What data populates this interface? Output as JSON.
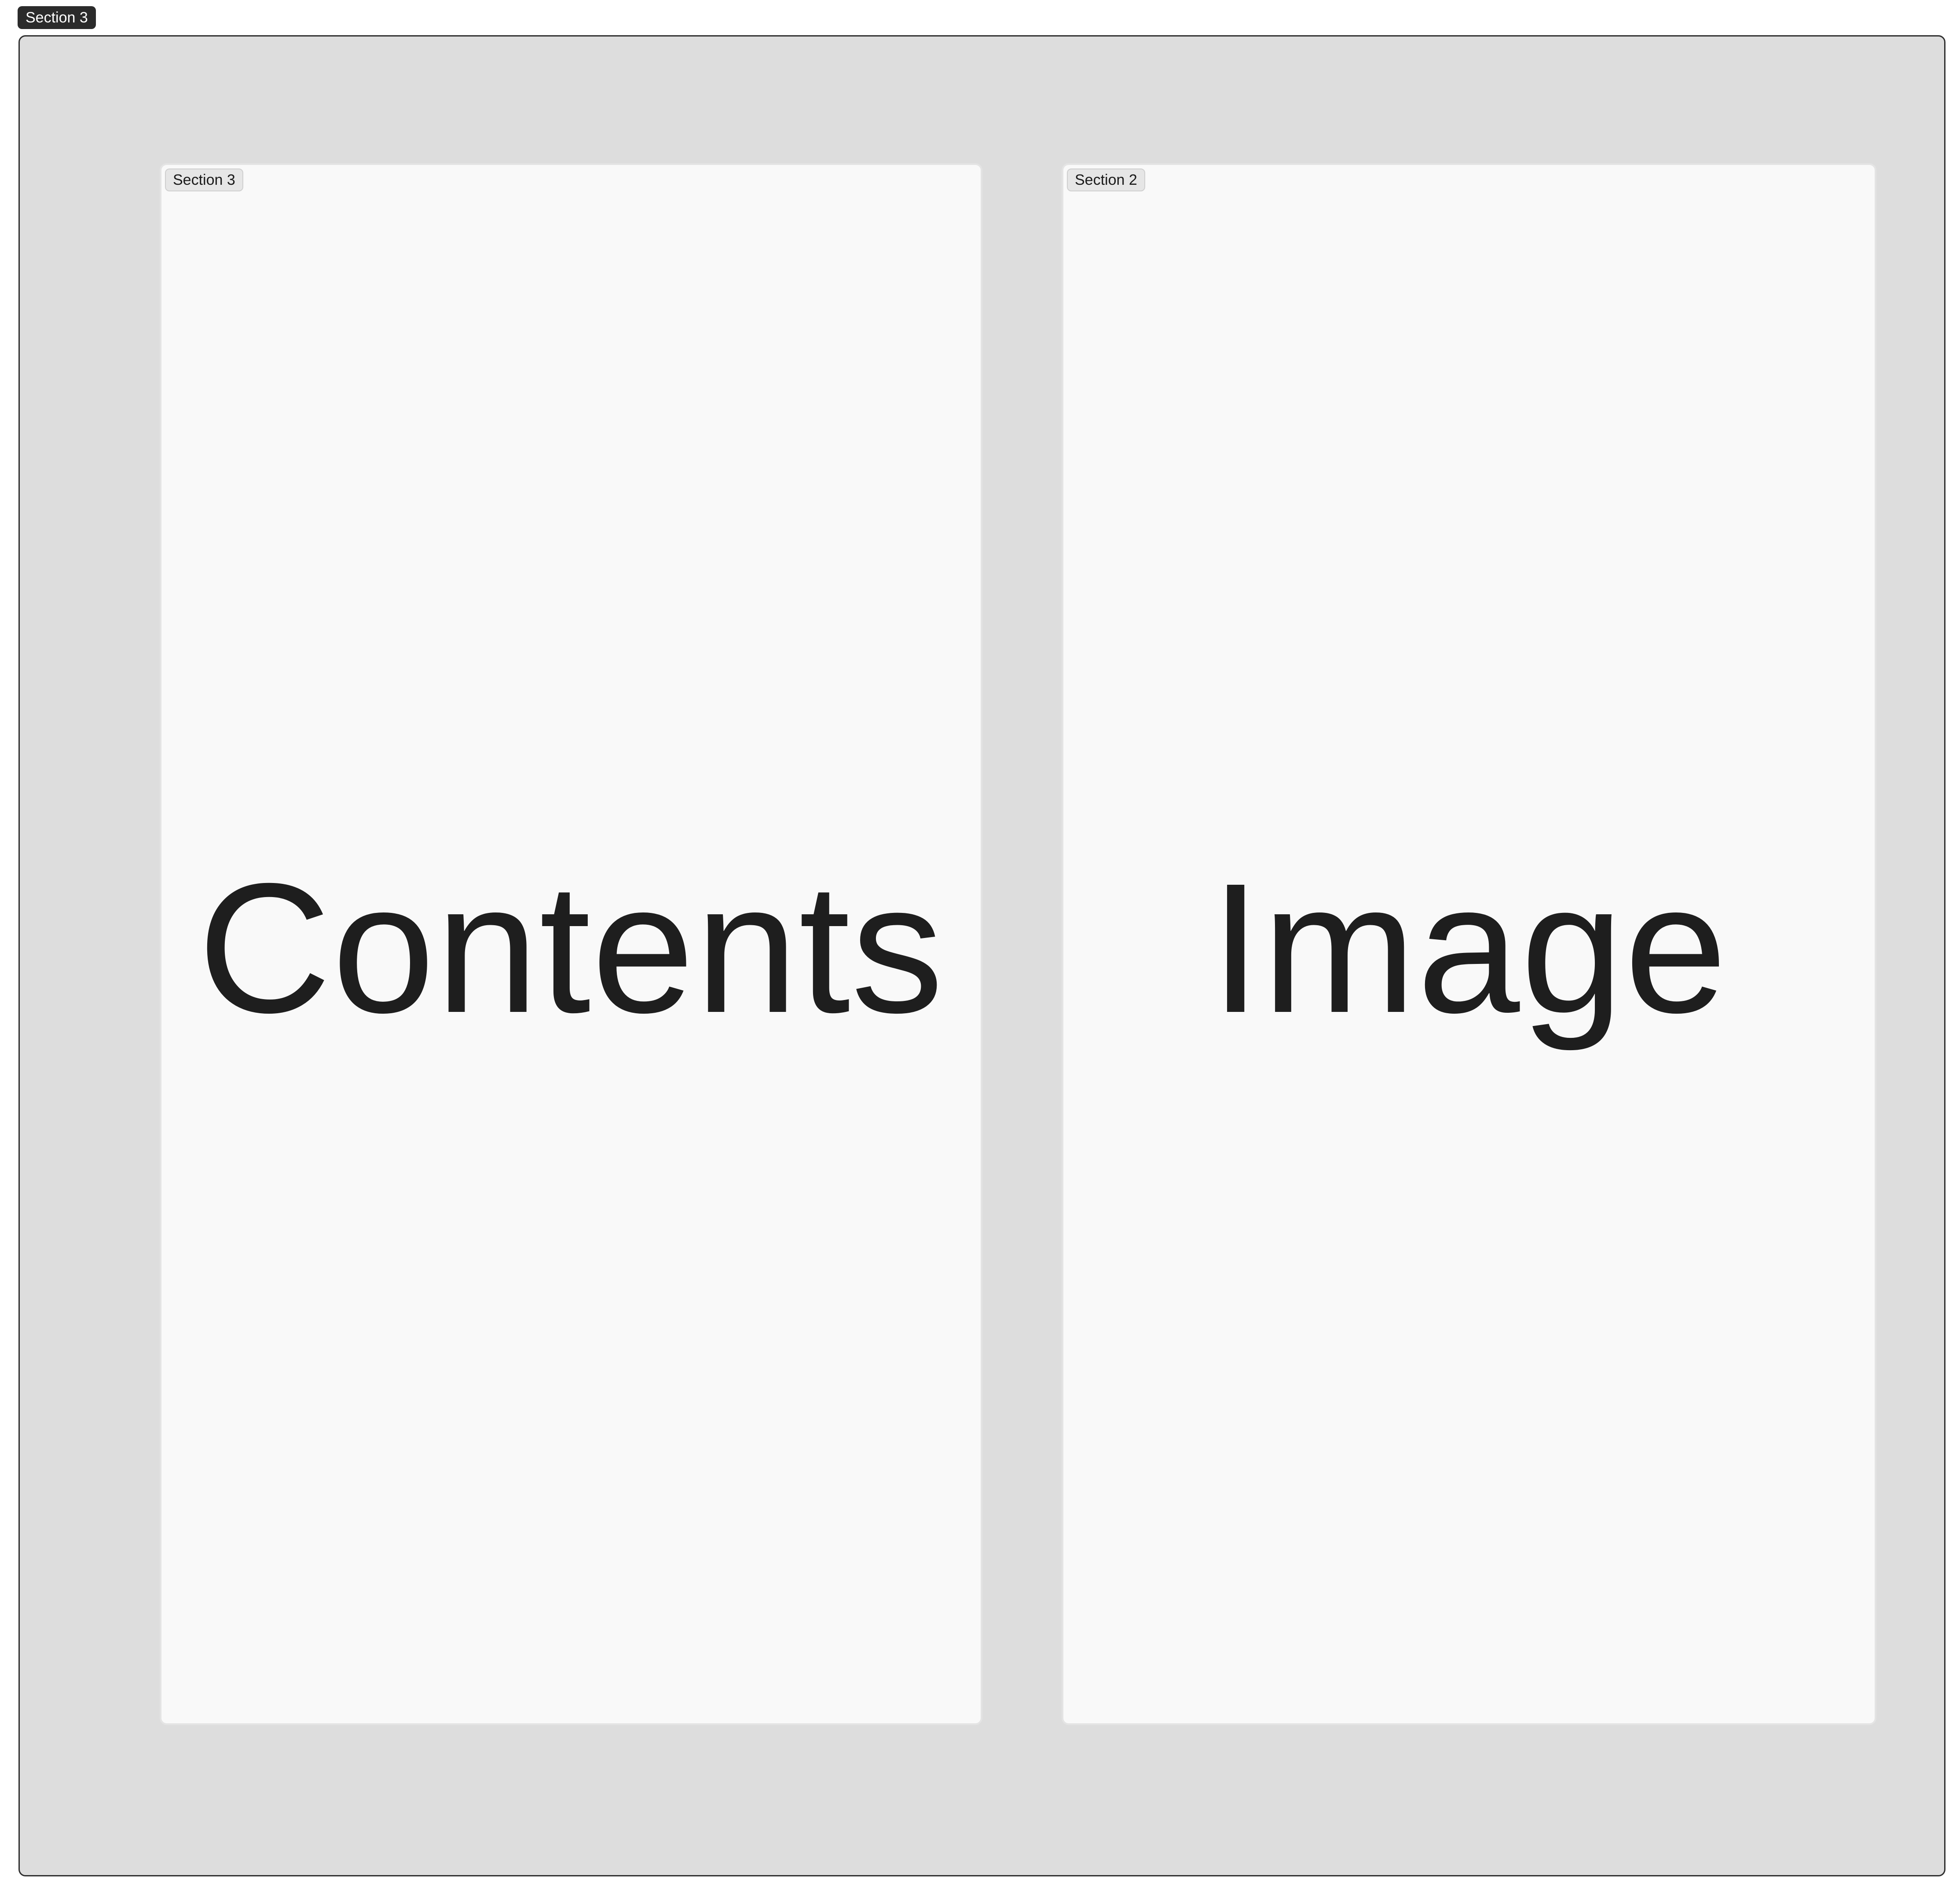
{
  "frame": {
    "label": "Section 3"
  },
  "panels": [
    {
      "tag": "Section 3",
      "content": "Contents"
    },
    {
      "tag": "Section 2",
      "content": "Image"
    }
  ],
  "colors": {
    "frame_background": "#dddddd",
    "frame_border": "#2f2f2f",
    "frame_tag_background": "#2b2b2b",
    "panel_background": "#f9f9f9",
    "panel_border": "#e4e4e4",
    "panel_tag_background": "#e6e6e6",
    "text": "#1e1e1e"
  }
}
